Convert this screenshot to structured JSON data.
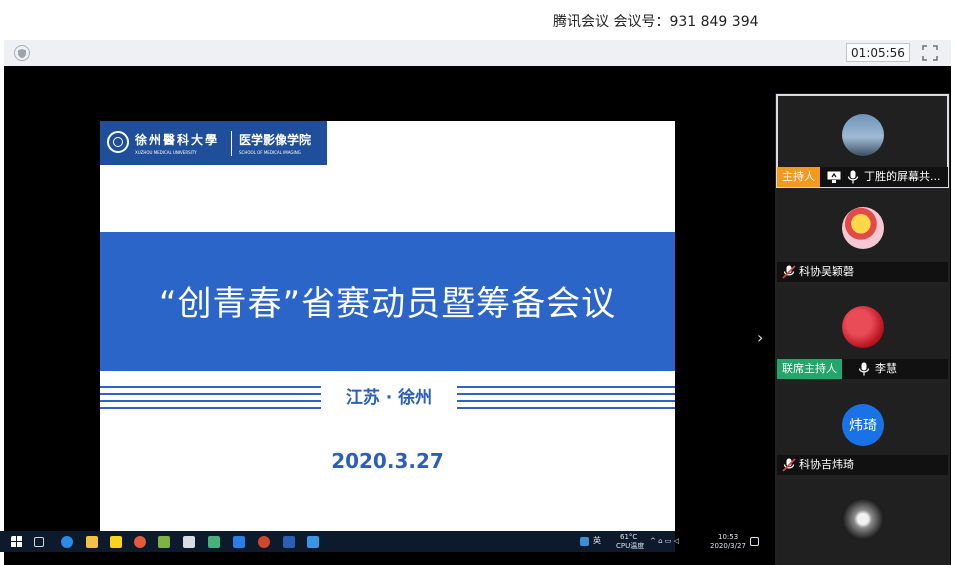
{
  "app": {
    "title": "腾讯会议 会议号：931 849 394",
    "timer": "01:05:56"
  },
  "slide": {
    "logo_cn": "徐州醫科大學",
    "logo_en": "XUZHOU MEDICAL UNIVERSITY",
    "school_cn": "医学影像学院",
    "school_en": "SCHOOL OF MEDICAL IMAGING",
    "headline": "“创青春”省赛动员暨筹备会议",
    "location": "江苏 · 徐州",
    "date": "2020.3.27"
  },
  "taskbar": {
    "ime": "英",
    "temp": "61°C",
    "cpu": "CPU温度",
    "time": "10:53",
    "date": "2020/3/27"
  },
  "participants": [
    {
      "name": "丁胜的屏幕共...",
      "tag": "主持人",
      "tag_color": "#f39a1e",
      "sharing": true
    },
    {
      "name": "科协吴颖磬",
      "tag": "",
      "sharing": false
    },
    {
      "name": "李慧",
      "tag": "联席主持人",
      "tag_color": "#21a66b",
      "sharing": false
    },
    {
      "name": "科协吉炜琦",
      "tag": "",
      "avatar_text": "炜琦",
      "avatar_color": "#1a72e8",
      "sharing": false
    }
  ],
  "icons": {
    "shield": "shield-icon",
    "fullscreen": "fullscreen-icon",
    "next": "chevron-right-icon",
    "mic": "microphone-icon",
    "share": "screen-share-icon"
  }
}
